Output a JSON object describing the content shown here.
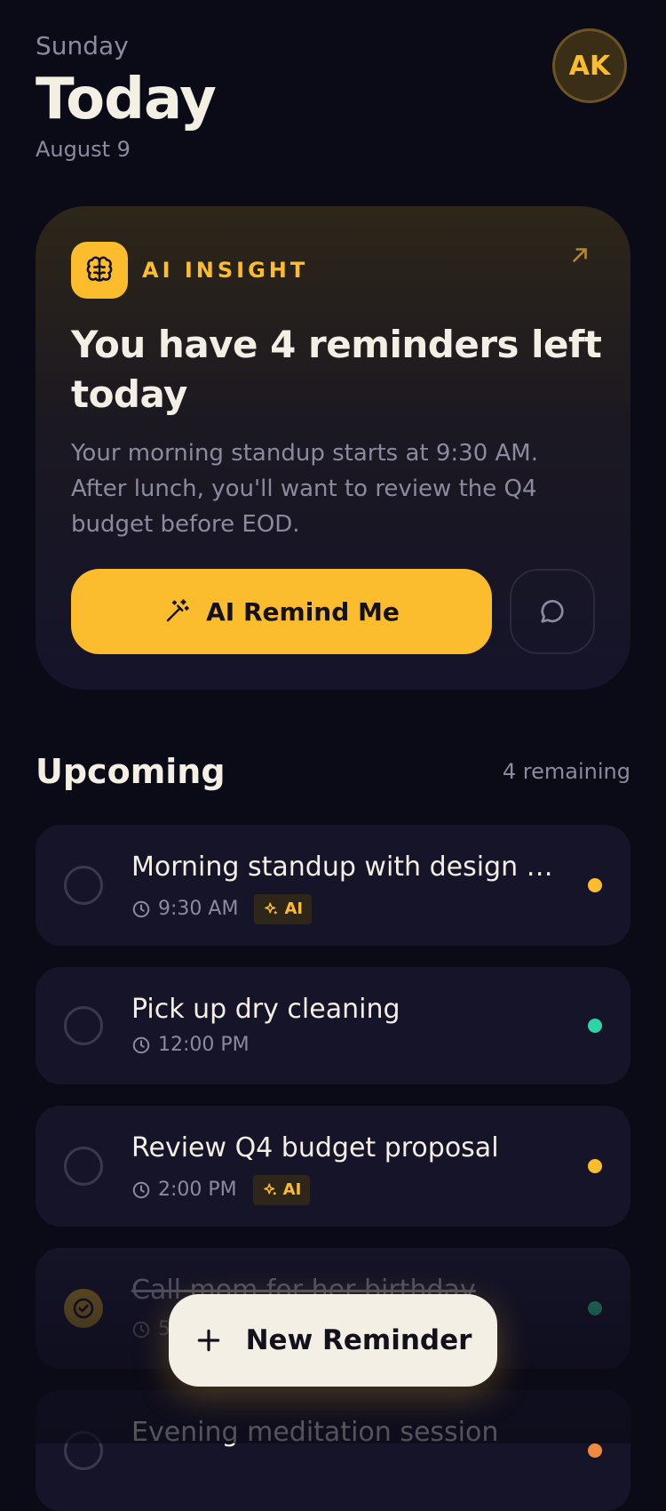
{
  "header": {
    "day": "Sunday",
    "title": "Today",
    "date": "August 9",
    "avatar_initials": "AK"
  },
  "insight": {
    "label": "AI INSIGHT",
    "headline": "You have 4 reminders left today",
    "body": "Your morning standup starts at 9:30 AM. After lunch, you'll want to review the Q4 budget before EOD.",
    "primary_button": "AI Remind Me",
    "icons": {
      "badge": "brain-icon",
      "expand": "arrow-up-right-icon",
      "primary": "magic-wand-icon",
      "chat": "chat-bubble-icon"
    }
  },
  "upcoming": {
    "title": "Upcoming",
    "count_label": "4 remaining",
    "items": [
      {
        "title": "Morning standup with design te...",
        "time": "9:30 AM",
        "ai": "AI",
        "done": false,
        "dot": "#fbbd2e"
      },
      {
        "title": "Pick up dry cleaning",
        "time": "12:00 PM",
        "ai": "",
        "done": false,
        "dot": "#2dd4a4"
      },
      {
        "title": "Review Q4 budget proposal",
        "time": "2:00 PM",
        "ai": "AI",
        "done": false,
        "dot": "#fbbd2e"
      },
      {
        "title": "Call mom for her birthday",
        "time": "5",
        "ai": "",
        "done": true,
        "dot": "#1f7a62"
      },
      {
        "title": "Evening meditation session",
        "time": "",
        "ai": "",
        "done": false,
        "dot": "#f08a3c"
      }
    ]
  },
  "fab": {
    "label": "New Reminder",
    "icon": "plus-icon"
  },
  "colors": {
    "background": "#0b0a17",
    "accent": "#fbbd2e",
    "card": "#151428",
    "text": "#f4efe4",
    "muted": "#8c8a9e"
  }
}
